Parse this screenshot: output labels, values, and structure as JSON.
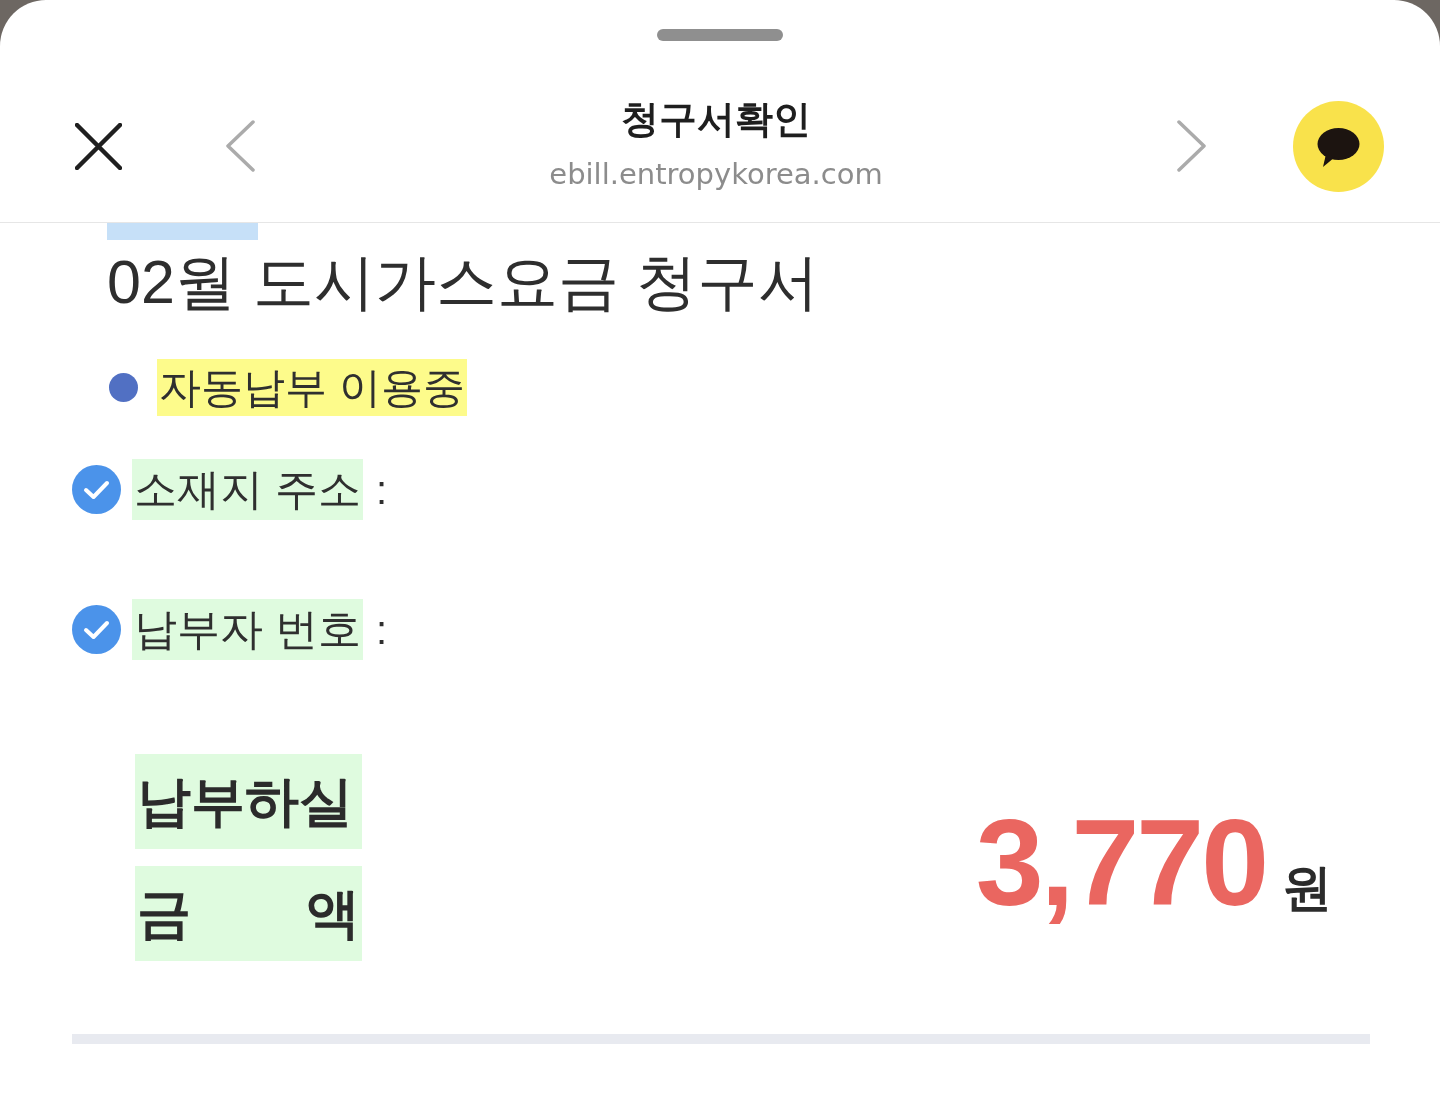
{
  "header": {
    "title": "청구서확인",
    "url": "ebill.entropykorea.com"
  },
  "bill": {
    "title": "02월 도시가스요금 청구서",
    "status": "자동납부 이용중",
    "fields": [
      {
        "label": "소재지 주소",
        "separator": ":"
      },
      {
        "label": "납부자 번호",
        "separator": ":"
      }
    ],
    "amount": {
      "label_lines": [
        "납부하실",
        "금 액"
      ],
      "value": "3,770",
      "unit": "원"
    }
  }
}
